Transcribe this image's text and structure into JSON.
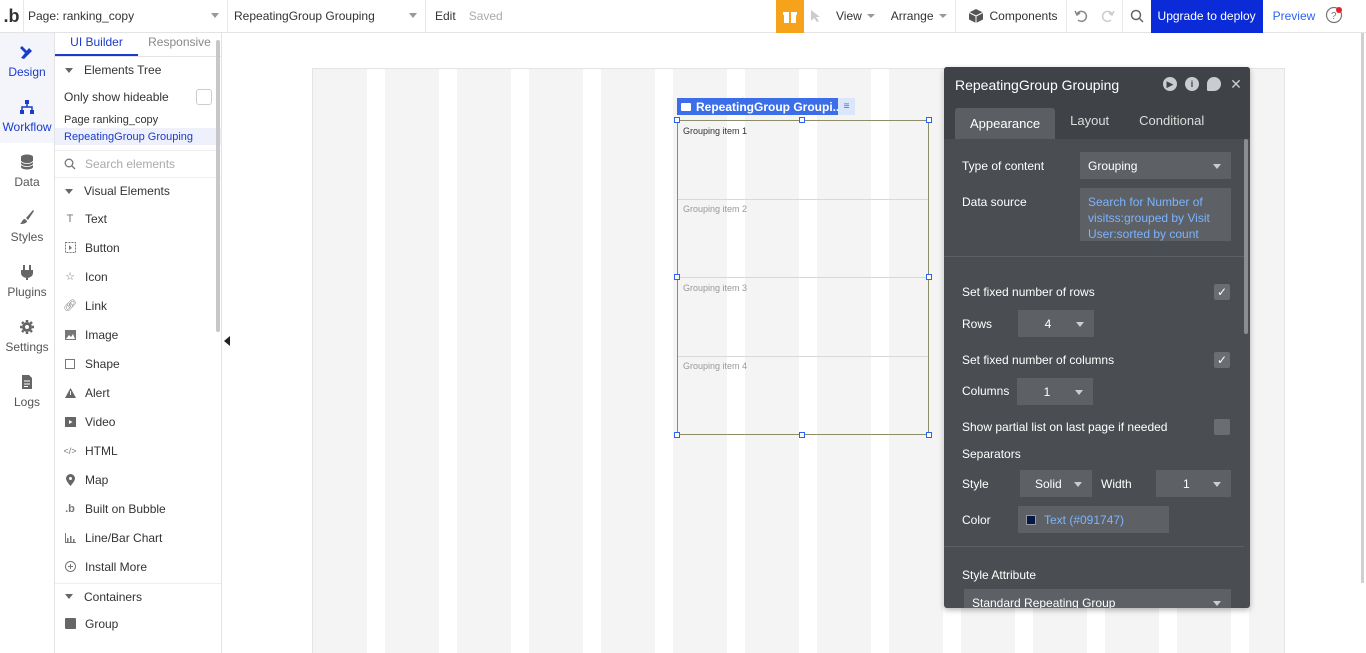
{
  "topbar": {
    "logo": ".b",
    "page_dropdown": "Page: ranking_copy",
    "element_dropdown": "RepeatingGroup Grouping",
    "edit": "Edit",
    "saved": "Saved",
    "gift_icon": "gift-icon",
    "view": "View",
    "arrange": "Arrange",
    "components": "Components",
    "upgrade": "Upgrade to deploy",
    "preview": "Preview"
  },
  "rail": [
    {
      "label": "Design",
      "icon": "design-icon"
    },
    {
      "label": "Workflow",
      "icon": "workflow-icon"
    },
    {
      "label": "Data",
      "icon": "database-icon"
    },
    {
      "label": "Styles",
      "icon": "brush-icon"
    },
    {
      "label": "Plugins",
      "icon": "plug-icon"
    },
    {
      "label": "Settings",
      "icon": "gear-icon"
    },
    {
      "label": "Logs",
      "icon": "document-icon"
    }
  ],
  "panel": {
    "tab_ui": "UI Builder",
    "tab_responsive": "Responsive",
    "elements_tree": "Elements Tree",
    "only_show_hideable": "Only show hideable",
    "tree_page": "Page ranking_copy",
    "tree_rg": "RepeatingGroup Grouping",
    "search_placeholder": "Search elements",
    "visual_elements": "Visual Elements",
    "elements": [
      "Text",
      "Button",
      "Icon",
      "Link",
      "Image",
      "Shape",
      "Alert",
      "Video",
      "HTML",
      "Map",
      "Built on Bubble",
      "Line/Bar Chart",
      "Install More"
    ],
    "containers": "Containers",
    "group": "Group"
  },
  "canvas": {
    "rg_label": "RepeatingGroup Groupi...",
    "cells": [
      "Grouping item 1",
      "Grouping item 2",
      "Grouping item 3",
      "Grouping item 4"
    ]
  },
  "editor": {
    "title": "RepeatingGroup Grouping",
    "tabs": [
      "Appearance",
      "Layout",
      "Conditional"
    ],
    "type_of_content_label": "Type of content",
    "type_of_content_value": "Grouping",
    "data_source_label": "Data source",
    "data_source_value": "Search for Number of visitss:grouped by Visit User:sorted by count",
    "fixed_rows_label": "Set fixed number of rows",
    "rows_label": "Rows",
    "rows_value": "4",
    "fixed_cols_label": "Set fixed number of columns",
    "cols_label": "Columns",
    "cols_value": "1",
    "partial_label": "Show partial list on last page if needed",
    "separators_label": "Separators",
    "style_label": "Style",
    "style_value": "Solid",
    "width_label": "Width",
    "width_value": "1",
    "color_label": "Color",
    "color_value": "Text (#091747)",
    "style_attr_label": "Style Attribute",
    "style_attr_value": "Standard Repeating Group"
  },
  "colors": {
    "accent": "#1a3bcd",
    "upgrade": "#0b2bd9",
    "gift": "#f7a21b",
    "editor_bg": "#4a4d51",
    "link": "#7bb3ff",
    "separator_color": "#091747"
  }
}
